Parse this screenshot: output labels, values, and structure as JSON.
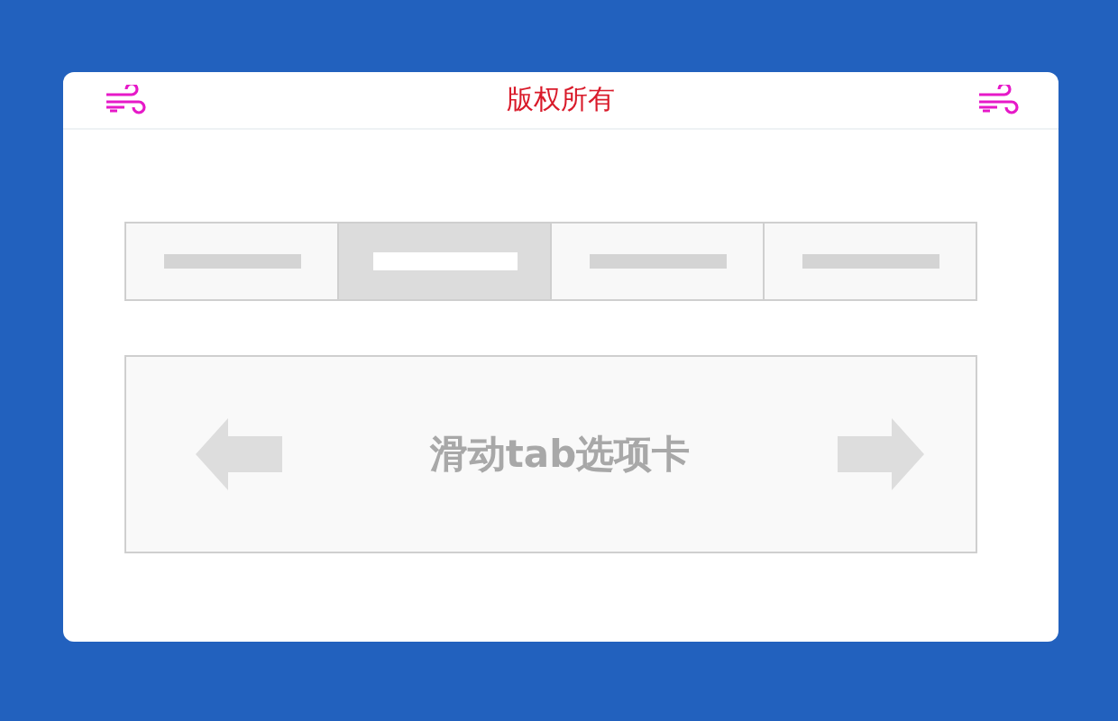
{
  "header": {
    "title": "版权所有"
  },
  "tabs": [
    {
      "selected": false
    },
    {
      "selected": true
    },
    {
      "selected": false
    },
    {
      "selected": false
    }
  ],
  "slide": {
    "title": "滑动tab选项卡"
  }
}
